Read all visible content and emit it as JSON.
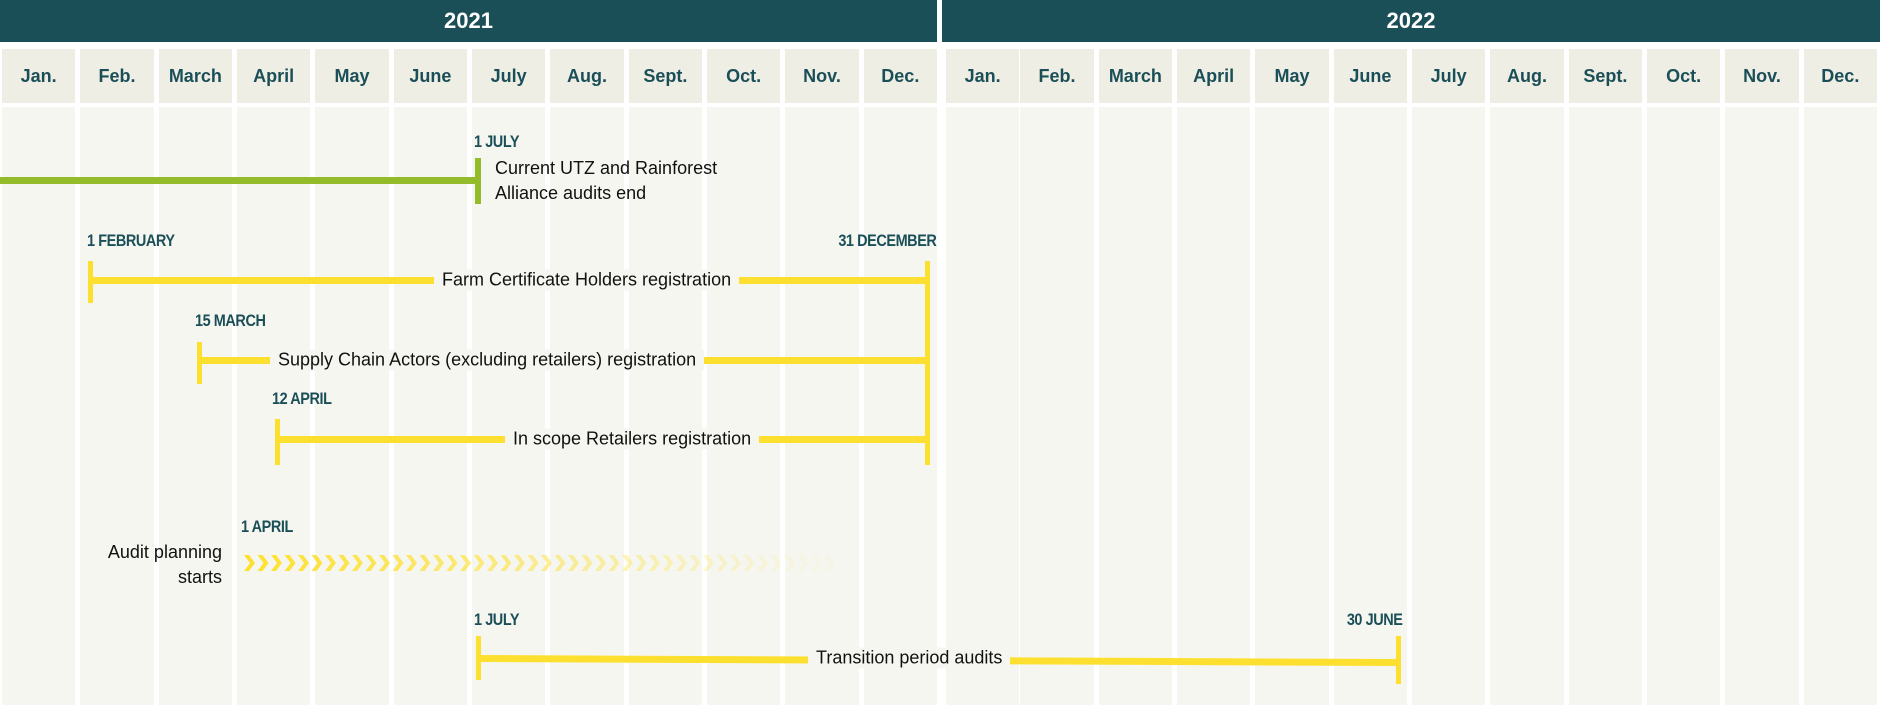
{
  "years": [
    "2021",
    "2022"
  ],
  "months": [
    "Jan.",
    "Feb.",
    "March",
    "April",
    "May",
    "June",
    "July",
    "Aug.",
    "Sept.",
    "Oct.",
    "Nov.",
    "Dec.",
    "Jan.",
    "Feb.",
    "March",
    "April",
    "May",
    "June",
    "July",
    "Aug.",
    "Sept.",
    "Oct.",
    "Nov.",
    "Dec."
  ],
  "colors": {
    "header": "#1b4f58",
    "green": "#93bb2a",
    "yellow": "#fde02f",
    "month_bg": "#efeee5",
    "body_bg": "#f6f6f1"
  },
  "events": {
    "audits_end": {
      "date": "1 JULY",
      "text_line1": "Current UTZ and Rainforest",
      "text_line2": "Alliance audits end"
    },
    "farm": {
      "start": "1 FEBRUARY",
      "end": "31 DECEMBER",
      "label": "Farm Certificate Holders registration"
    },
    "supply": {
      "start": "15 MARCH",
      "label": "Supply Chain Actors (excluding retailers) registration"
    },
    "retailers": {
      "start": "12 APRIL",
      "label": "In scope Retailers registration"
    },
    "audit_planning": {
      "start": "1 APRIL",
      "text_line1": "Audit planning",
      "text_line2": "starts"
    },
    "transition": {
      "start": "1 JULY",
      "end": "30 JUNE",
      "label": "Transition period audits"
    }
  }
}
